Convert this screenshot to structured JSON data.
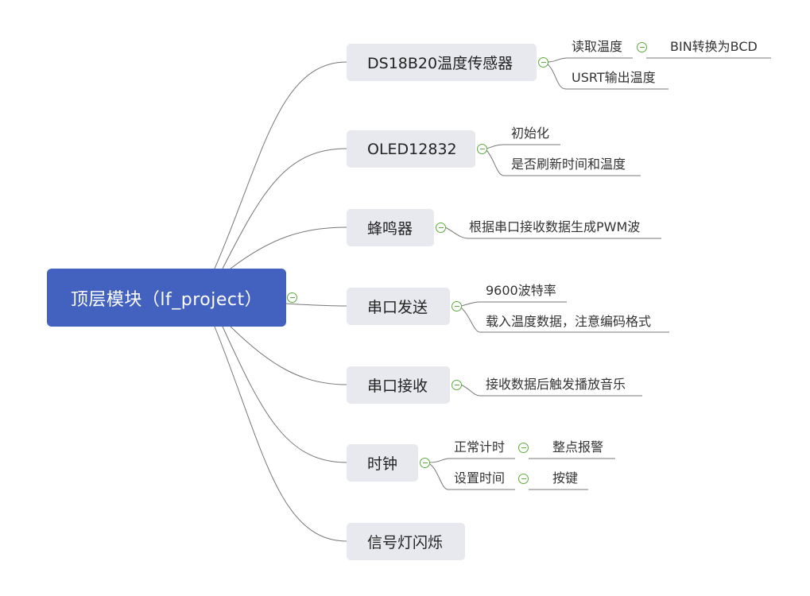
{
  "root": {
    "label": "顶层模块（lf_project）"
  },
  "colors": {
    "root_fill": "#4361be",
    "topic_fill": "#e8e9ef",
    "toggle": "#5cab3c",
    "line": "#777777"
  },
  "icons": {
    "collapse": "collapse-minus-icon"
  },
  "topics": [
    {
      "label": "DS18B20温度传感器",
      "children": [
        {
          "label": "读取温度",
          "child": "BIN转换为BCD"
        },
        {
          "label": "USRT输出温度"
        }
      ]
    },
    {
      "label": "OLED12832",
      "children": [
        {
          "label": "初始化"
        },
        {
          "label": "是否刷新时间和温度"
        }
      ]
    },
    {
      "label": "蜂鸣器",
      "children": [
        {
          "label": "根据串口接收数据生成PWM波"
        }
      ]
    },
    {
      "label": "串口发送",
      "children": [
        {
          "label": "9600波特率"
        },
        {
          "label": "载入温度数据，注意编码格式"
        }
      ]
    },
    {
      "label": "串口接收",
      "children": [
        {
          "label": "接收数据后触发播放音乐"
        }
      ]
    },
    {
      "label": "时钟",
      "children": [
        {
          "label": "正常计时",
          "child": "整点报警"
        },
        {
          "label": "设置时间",
          "child": "按键"
        }
      ]
    },
    {
      "label": "信号灯闪烁",
      "children": []
    }
  ]
}
